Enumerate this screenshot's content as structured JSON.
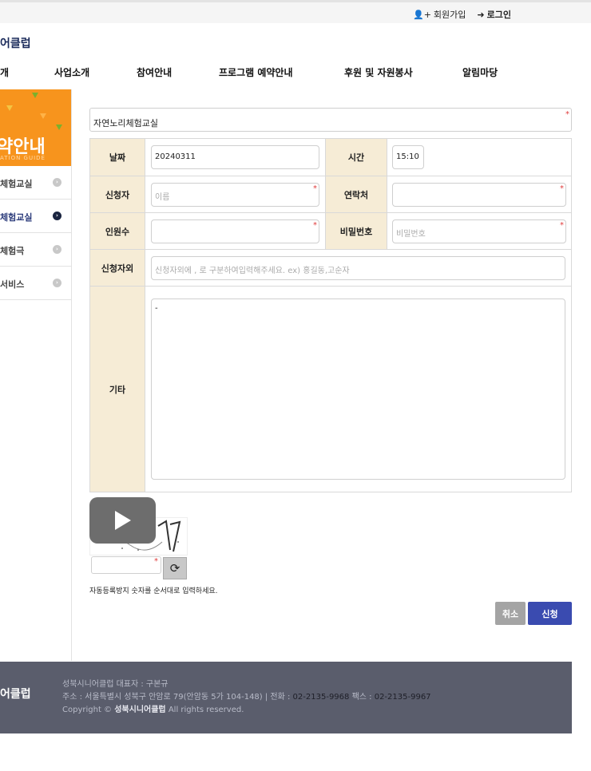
{
  "top_links": {
    "join": "회원가입",
    "login": "로그인"
  },
  "logo": "어클럽",
  "gnb": [
    "개",
    "사업소개",
    "참여안내",
    "프로그램 예약안내",
    "후원 및 자원봉사",
    "알림마당"
  ],
  "side": {
    "banner_title": "약안내",
    "banner_sub": "ATION GUIDE",
    "items": [
      {
        "label": "체험교실",
        "active": false
      },
      {
        "label": "체험교실",
        "active": true
      },
      {
        "label": "체험극",
        "active": false
      },
      {
        "label": "서비스",
        "active": false
      }
    ]
  },
  "form": {
    "program_name": "자연노리체험교실",
    "date_label": "날짜",
    "date_value": "20240311",
    "time_label": "시간",
    "time_value": "15:10",
    "applicant_label": "신청자",
    "applicant_placeholder": "이름",
    "contact_label": "연락처",
    "count_label": "인원수",
    "password_label": "비밀번호",
    "password_placeholder": "비밀번호",
    "others_label": "신청자외",
    "others_placeholder": "신청자외에 , 로 구분하여입력해주세요. ex) 홍길동,고순자",
    "etc_label": "기타",
    "etc_value": "-"
  },
  "captcha": {
    "note": "자동등록방지 숫자를 순서대로 입력하세요."
  },
  "buttons": {
    "cancel": "취소",
    "submit": "신청"
  },
  "footer": {
    "logo": "어클럽",
    "rep": "성북시니어클럽 대표자 : 구본규",
    "address": "주소 : 서울특별시 성북구 안암로 79(안암동 5가 104-148) | 전화 : ",
    "phone": "02-2135-9968",
    "fax_label": " 팩스 : ",
    "fax": "02-2135-9967",
    "copyright_pre": "Copyright © ",
    "copyright_name": "성북시니어클럽",
    "copyright_post": " All rights reserved."
  }
}
